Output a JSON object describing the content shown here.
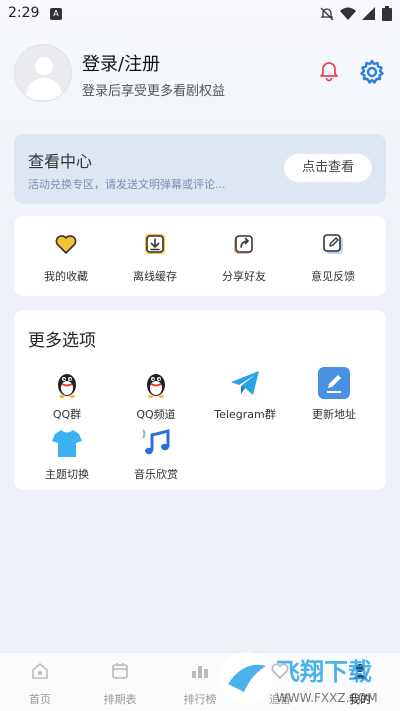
{
  "status_bar": {
    "time": "2:29",
    "notif_badge": "A"
  },
  "profile": {
    "title": "登录/注册",
    "subtitle": "登录后享受更多看剧权益"
  },
  "watch_center": {
    "title": "查看中心",
    "subtitle": "活动兑换专区，请发送文明弹幕或评论...",
    "button": "点击查看"
  },
  "quick_actions": [
    {
      "label": "我的收藏",
      "icon": "heart-icon"
    },
    {
      "label": "离线缓存",
      "icon": "download-icon"
    },
    {
      "label": "分享好友",
      "icon": "share-icon"
    },
    {
      "label": "意见反馈",
      "icon": "edit-icon"
    }
  ],
  "more_options": {
    "title": "更多选项",
    "items": [
      {
        "label": "QQ群",
        "icon": "qq-icon"
      },
      {
        "label": "QQ频道",
        "icon": "qq-icon"
      },
      {
        "label": "Telegram群",
        "icon": "telegram-icon"
      },
      {
        "label": "更新地址",
        "icon": "pencil-icon"
      },
      {
        "label": "主题切换",
        "icon": "tshirt-icon"
      },
      {
        "label": "音乐欣赏",
        "icon": "music-icon"
      }
    ]
  },
  "bottom_nav": [
    {
      "label": "首页",
      "icon": "home-icon"
    },
    {
      "label": "排期表",
      "icon": "calendar-icon"
    },
    {
      "label": "排行榜",
      "icon": "ranking-icon"
    },
    {
      "label": "追番",
      "icon": "follow-icon"
    },
    {
      "label": "我的",
      "icon": "user-icon"
    }
  ],
  "watermark": {
    "text_cn": "飞翔下载",
    "text_url": "WWW.FXXZ.COM"
  },
  "colors": {
    "accent": "#2d7ee0",
    "watch_card_bg": "#dde6f1",
    "watch_sub": "#7b8fb3",
    "heart": "#f2c230",
    "telegram": "#2aa3e8"
  }
}
